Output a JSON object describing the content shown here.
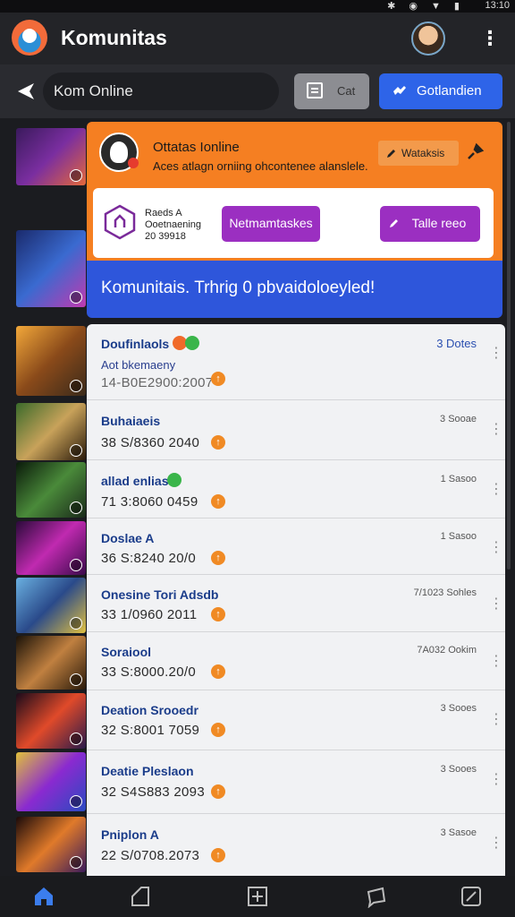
{
  "status_bar": {
    "icons": "✱ ◉ ▼ ▮",
    "time": "13:10"
  },
  "app_bar": {
    "title": "Komunitas",
    "more": "⋮"
  },
  "search": {
    "value": "Kom Online",
    "btn_grey": "Cat",
    "btn_blue": "Gotlandien"
  },
  "featured": {
    "title": "Ottatas Ionline",
    "subtitle": "Aces atlagn orniing ohcontenee alanslele.",
    "edit_label": "Wataksis",
    "panel_text_1": "Raeds A",
    "panel_text_2": "Ooetnaening",
    "panel_text_3": "20 39918",
    "button_a": "Netmamtaskes",
    "button_b": "Talle reeo",
    "banner": "Komunitais. Trhrig 0 pbvaidoloeyled!"
  },
  "rows": [
    {
      "name": "Doufinlaols",
      "sub": "Aot bkemaeny",
      "num": "14-B0E2900:2007",
      "time": "3 Dotes",
      "time_blue": true
    },
    {
      "name": "Buhaiaeis",
      "sub": "",
      "num": "38 S/8360 2040",
      "time": "3 Sooae",
      "time_blue": false
    },
    {
      "name": "allad enlias",
      "sub": "",
      "num": "71 3:8060 0459",
      "time": "1 Sasoo",
      "time_blue": false
    },
    {
      "name": "Doslae A",
      "sub": "",
      "num": "36 S:8240 20/0",
      "time": "1 Sasoo",
      "time_blue": false
    },
    {
      "name": "Onesine Tori Adsdb",
      "sub": "",
      "num": "33 1/0960 2011",
      "time": "7/1023 Sohles",
      "time_blue": false
    },
    {
      "name": "Soraiool",
      "sub": "",
      "num": "33 S:8000.20/0",
      "time": "7A032 Ookim",
      "time_blue": false
    },
    {
      "name": "Deation Srooedr",
      "sub": "",
      "num": "32 S:8001 7059",
      "time": "3 Sooes",
      "time_blue": false
    },
    {
      "name": "Deatie Pleslaon",
      "sub": "",
      "num": "32 S4S883 2093",
      "time": "3 Sooes",
      "time_blue": false
    },
    {
      "name": "Pniplon A",
      "sub": "",
      "num": "22 S/0708.2073",
      "time": "3 Sasoe",
      "time_blue": false
    }
  ],
  "colors": {
    "accent_orange": "#f57f22",
    "accent_blue": "#2e56db",
    "accent_purple": "#9b2fc1"
  }
}
